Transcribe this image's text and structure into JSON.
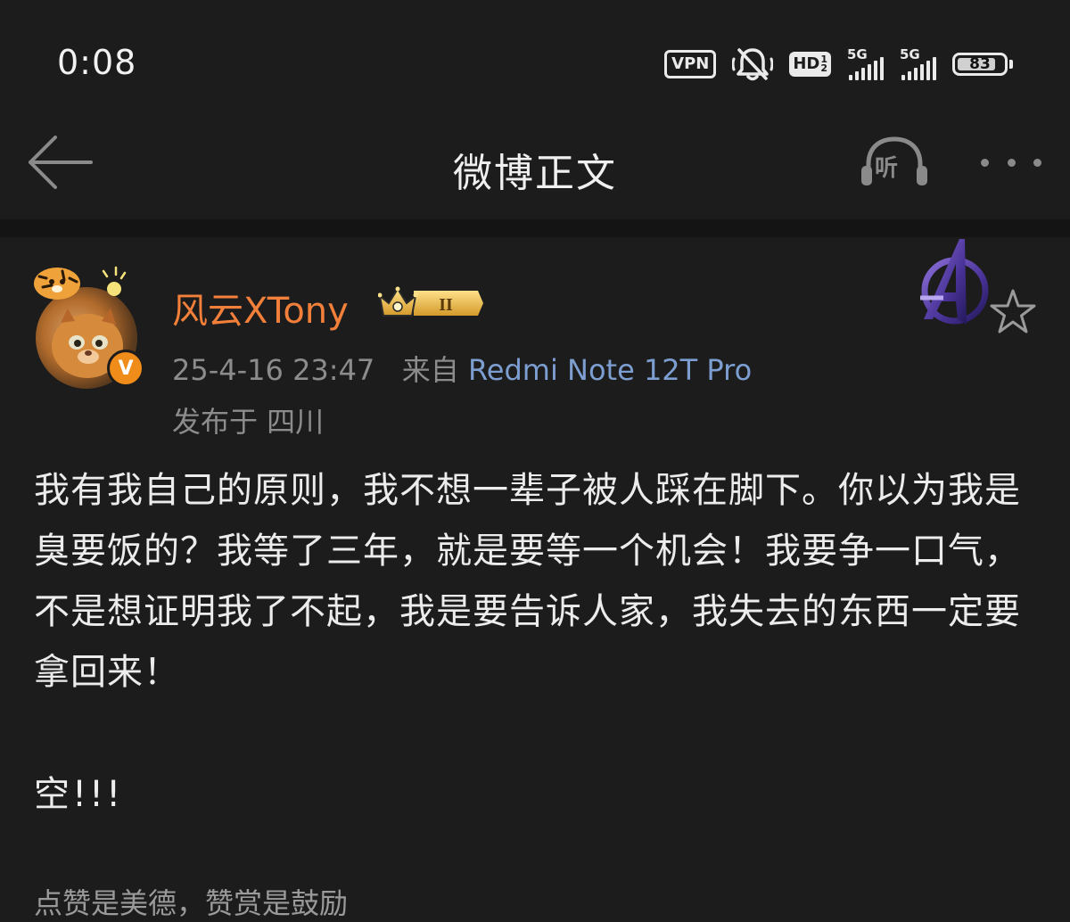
{
  "status_bar": {
    "time": "0:08",
    "vpn": "VPN",
    "hd": "HD",
    "hd_sub_top": "1",
    "hd_sub_bottom": "2",
    "sim1_label": "5G",
    "sim2_label": "5G",
    "battery_level": 83,
    "battery_text": "83"
  },
  "nav": {
    "title": "微博正文",
    "listen_label": "听"
  },
  "post": {
    "author": "风云XTony",
    "vip_level_label": "II",
    "verified_mark": "V",
    "timestamp": "25-4-16 23:47",
    "source_prefix": "来自",
    "source": "Redmi Note 12T Pro",
    "location": "发布于 四川",
    "body": "我有我自己的原则，我不想一辈子被人踩在脚下。你以为我是臭要饭的？我等了三年，就是要等一个机会！我要争一口气，不是想证明我了不起，我是要告诉人家，我失去的东西一定要拿回来！",
    "body_extra": "空!!!",
    "body_cut": "点赞是美德，赞赏是鼓励"
  },
  "colors": {
    "background": "#1c1c1c",
    "username": "#f27f3a",
    "source_link": "#7d9ed1",
    "meta": "#8c8c8c",
    "verified": "#f08c19"
  }
}
